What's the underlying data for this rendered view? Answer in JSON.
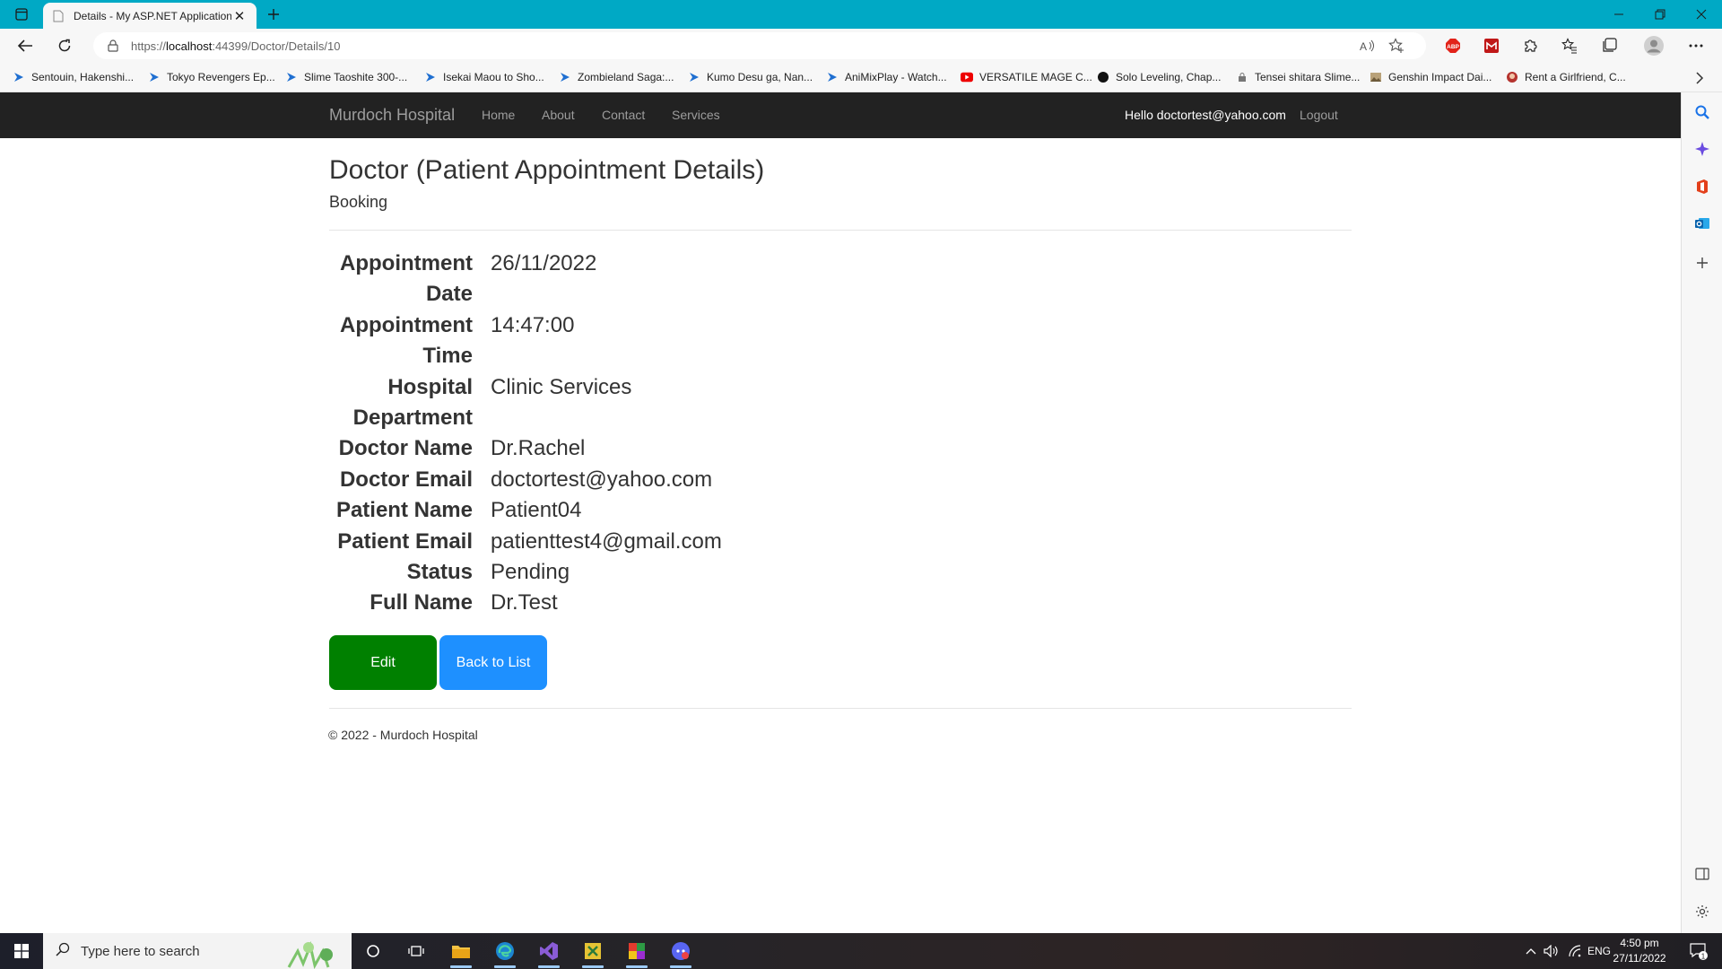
{
  "browser": {
    "tab_title": "Details - My ASP.NET Application",
    "url_prefix": "https://",
    "url_host": "localhost",
    "url_rest": ":44399/Doctor/Details/10",
    "favorites": [
      "Sentouin, Hakenshi...",
      "Tokyo Revengers Ep...",
      "Slime Taoshite 300-...",
      "Isekai Maou to Sho...",
      "Zombieland Saga:...",
      "Kumo Desu ga, Nan...",
      "AniMixPlay - Watch...",
      "VERSATILE MAGE C...",
      "Solo Leveling, Chap...",
      "Tensei shitara Slime...",
      "Genshin Impact Dai...",
      "Rent a Girlfriend, C..."
    ],
    "extension_abp": "ABP",
    "accent_color": "#00a9c5"
  },
  "site": {
    "brand": "Murdoch Hospital",
    "nav": [
      "Home",
      "About",
      "Contact",
      "Services"
    ],
    "hello": "Hello doctortest@yahoo.com",
    "logout": "Logout"
  },
  "page": {
    "title": "Doctor (Patient Appointment Details)",
    "subtitle": "Booking",
    "details": [
      {
        "label": "Appointment Date",
        "value": "26/11/2022"
      },
      {
        "label": "Appointment Time",
        "value": "14:47:00"
      },
      {
        "label": "Hospital Department",
        "value": "Clinic Services"
      },
      {
        "label": "Doctor Name",
        "value": "Dr.Rachel"
      },
      {
        "label": "Doctor Email",
        "value": "doctortest@yahoo.com"
      },
      {
        "label": "Patient Name",
        "value": "Patient04"
      },
      {
        "label": "Patient Email",
        "value": "patienttest4@gmail.com"
      },
      {
        "label": "Status",
        "value": "Pending"
      },
      {
        "label": "Full Name",
        "value": "Dr.Test"
      }
    ],
    "edit_label": "Edit",
    "back_label": "Back to List",
    "edit_color": "#008000",
    "back_color": "#1e90ff",
    "footer": "© 2022 - Murdoch Hospital"
  },
  "taskbar": {
    "search_placeholder": "Type here to search",
    "language": "ENG",
    "time": "4:50 pm",
    "date": "27/11/2022",
    "notification_count": "1"
  }
}
